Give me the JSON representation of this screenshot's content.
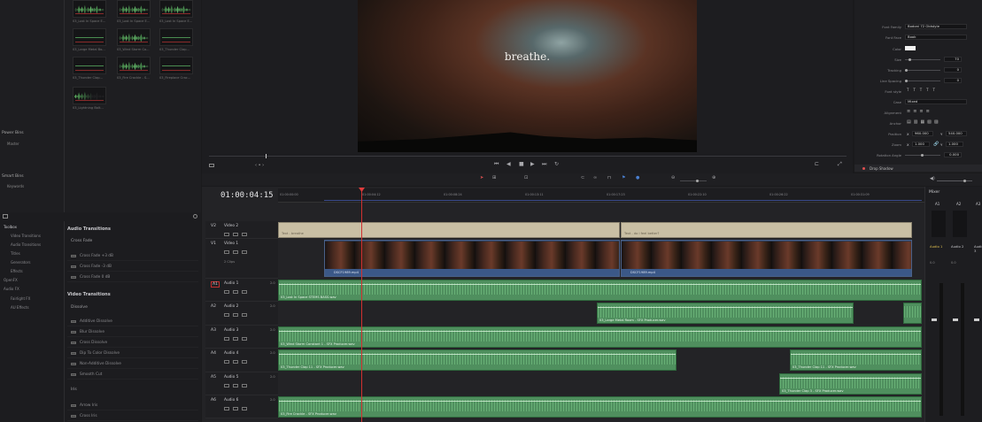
{
  "media_pool": {
    "clips": [
      {
        "label": "03_Lost In Space E...",
        "kind": "wave"
      },
      {
        "label": "03_Lost In Space E...",
        "kind": "wave"
      },
      {
        "label": "03_Lost In Space E...",
        "kind": "wave"
      },
      {
        "label": "03_Large Metal Bo...",
        "kind": "flat"
      },
      {
        "label": "03_Wind Storm Co...",
        "kind": "wave"
      },
      {
        "label": "03_Thunder Clap...",
        "kind": "flat"
      },
      {
        "label": "03_Thunder Clap...",
        "kind": "flat"
      },
      {
        "label": "03_Fire Crackle - S...",
        "kind": "wave"
      },
      {
        "label": "03_Fireplace Crac...",
        "kind": "flat"
      },
      {
        "label": "03_Lightning Bolt...",
        "kind": "decay"
      }
    ],
    "power_bins": "Power Bins",
    "power_bins_item": "Master",
    "smart_bins": "Smart Bins",
    "smart_bins_item": "Keywords"
  },
  "effects": {
    "tree": [
      "Toolbox",
      "Video Transitions",
      "Audio Transitions",
      "Titles",
      "Generators",
      "Effects",
      "OpenFX",
      "Audio FX",
      "Fairlight FX",
      "AU Effects"
    ],
    "audio_transitions_title": "Audio Transitions",
    "cross_fade_title": "Cross Fade",
    "cross_fade_items": [
      "Cross Fade +3 dB",
      "Cross Fade -3 dB",
      "Cross Fade 0 dB"
    ],
    "video_transitions_title": "Video Transitions",
    "dissolve_title": "Dissolve",
    "dissolve_items": [
      "Additive Dissolve",
      "Blur Dissolve",
      "Cross Dissolve",
      "Dip To Color Dissolve",
      "Non-Additive Dissolve",
      "Smooth Cut"
    ],
    "iris_title": "Iris",
    "iris_items": [
      "Arrow Iris",
      "Cross Iris"
    ]
  },
  "viewer": {
    "title_text": "breathe."
  },
  "inspector": {
    "font_family_label": "Font Family",
    "font_family_value": "Bodoni 72 Oldstyle",
    "font_face_label": "Font Face",
    "font_face_value": "Book",
    "color_label": "Color",
    "size_label": "Size",
    "size_value": "70",
    "tracking_label": "Tracking",
    "tracking_value": "0",
    "line_spacing_label": "Line Spacing",
    "line_spacing_value": "0",
    "case_label": "Case",
    "case_value": "Mixed",
    "font_style_label": "Font style",
    "alignment_label": "Alignment",
    "anchor_label": "Anchor",
    "position_label": "Position",
    "position_x": "960.000",
    "position_y": "540.000",
    "zoom_label": "Zoom",
    "zoom_x": "1.000",
    "zoom_y": "1.000",
    "rotation_label": "Rotation Angle",
    "rotation_value": "0.000",
    "drop_shadow_label": "Drop Shadow"
  },
  "timeline": {
    "timecode": "01:00:04:15",
    "ruler": [
      "01:00:00:00",
      "01:00:04:12",
      "01:00:08:24",
      "01:00:13:11",
      "01:00:17:23",
      "01:00:22:10",
      "01:00:26:22",
      "01:00:31:09"
    ],
    "tracks": [
      {
        "id": "V2",
        "name": "Video 2",
        "count": ""
      },
      {
        "id": "V1",
        "name": "Video 1",
        "count": "2 Clips"
      },
      {
        "id": "A1",
        "name": "Audio 1",
        "count": "2.0"
      },
      {
        "id": "A2",
        "name": "Audio 2",
        "count": "2.0"
      },
      {
        "id": "A3",
        "name": "Audio 3",
        "count": "2.0"
      },
      {
        "id": "A4",
        "name": "Audio 4",
        "count": "2.0"
      },
      {
        "id": "A5",
        "name": "Audio 5",
        "count": "2.0"
      },
      {
        "id": "A6",
        "name": "Audio 6",
        "count": "2.0"
      }
    ],
    "title_clips": [
      "Text - breathe",
      "Text - do i feel better?"
    ],
    "video_clips": [
      "DSCF1989.mp4",
      "DSCF1989.mp4"
    ],
    "audio_clips": {
      "a1": "03_Lost In Space STEMS BASS.wav",
      "a2": "03_Large Metal Room - SFX Producer.wav",
      "a3": "03_Wind Storm Constant 1 - SFX Producer.wav",
      "a4a": "03_Thunder Clap 11 - SFX Producer.wav",
      "a4b": "03_Thunder Clap 11 - SFX Producer.wav",
      "a5": "03_Thunder Clap 3 - SFX Producer.wav",
      "a6": "03_Fire Crackle - SFX Producer.wav"
    }
  },
  "mixer": {
    "title": "Mixer",
    "channels": [
      "A1",
      "A2",
      "A3"
    ],
    "strips": [
      "Audio 1",
      "Audio 2",
      "Audio 3"
    ],
    "gain": "0.0"
  }
}
